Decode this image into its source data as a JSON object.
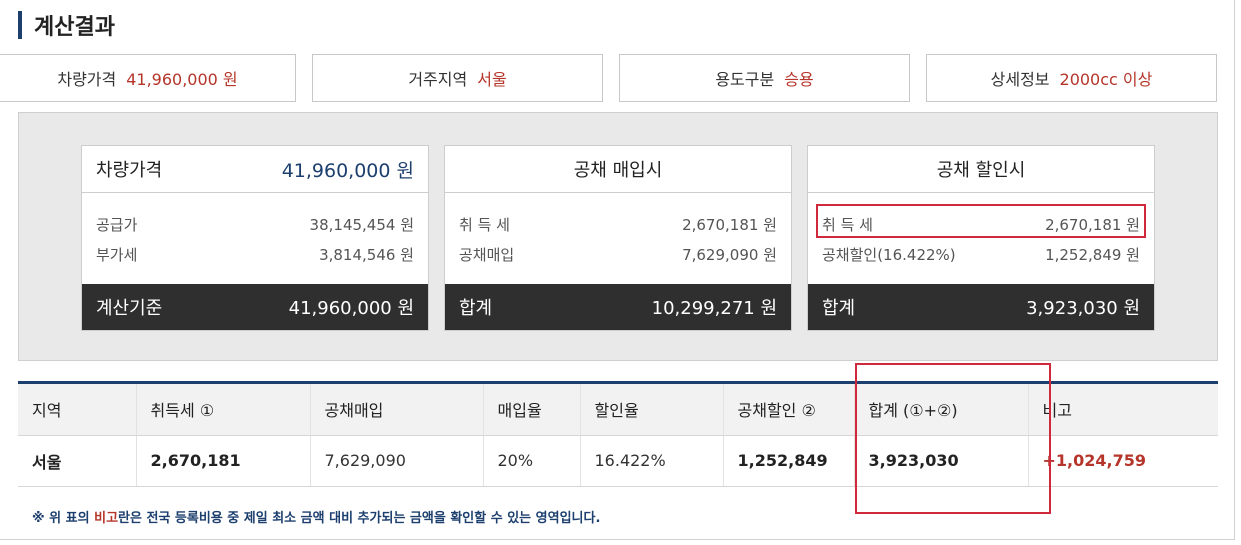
{
  "title": "계산결과",
  "info": [
    {
      "label": "차량가격",
      "value": "41,960,000 원"
    },
    {
      "label": "거주지역",
      "value": "서울"
    },
    {
      "label": "용도구분",
      "value": "승용"
    },
    {
      "label": "상세정보",
      "value": "2000cc 이상"
    }
  ],
  "cards": {
    "price": {
      "head_label": "차량가격",
      "head_value": "41,960,000 원",
      "rows": [
        {
          "label": "공급가",
          "value": "38,145,454 원"
        },
        {
          "label": "부가세",
          "value": "3,814,546 원"
        }
      ],
      "foot_label": "계산기준",
      "foot_value": "41,960,000 원"
    },
    "bond_buy": {
      "head_label": "공채 매입시",
      "rows": [
        {
          "label": "취 득 세",
          "value": "2,670,181 원"
        },
        {
          "label": "공채매입",
          "value": "7,629,090 원"
        }
      ],
      "foot_label": "합계",
      "foot_value": "10,299,271 원"
    },
    "bond_discount": {
      "head_label": "공채 할인시",
      "rows": [
        {
          "label": "취 득 세",
          "value": "2,670,181 원"
        },
        {
          "label": "공채할인(16.422%)",
          "value": "1,252,849 원"
        }
      ],
      "foot_label": "합계",
      "foot_value": "3,923,030 원"
    }
  },
  "table": {
    "headers": [
      "지역",
      "취득세 ①",
      "공채매입",
      "매입율",
      "할인율",
      "공채할인 ②",
      "합계 (①+②)",
      "비고"
    ],
    "row": [
      "서울",
      "2,670,181",
      "7,629,090",
      "20%",
      "16.422%",
      "1,252,849",
      "3,923,030",
      "+1,024,759"
    ]
  },
  "note": {
    "prefix": "※ 위 표의 ",
    "highlight": "비고",
    "suffix": "란은 전국 등록비용 중 제일 최소 금액 대비 추가되는 금액을 확인할 수 있는 영역입니다."
  },
  "colors": {
    "accent": "#1d3f6e",
    "value_red": "#b5352a",
    "highlight_box": "#d0293d",
    "footer_dark": "#2f2f2f"
  }
}
